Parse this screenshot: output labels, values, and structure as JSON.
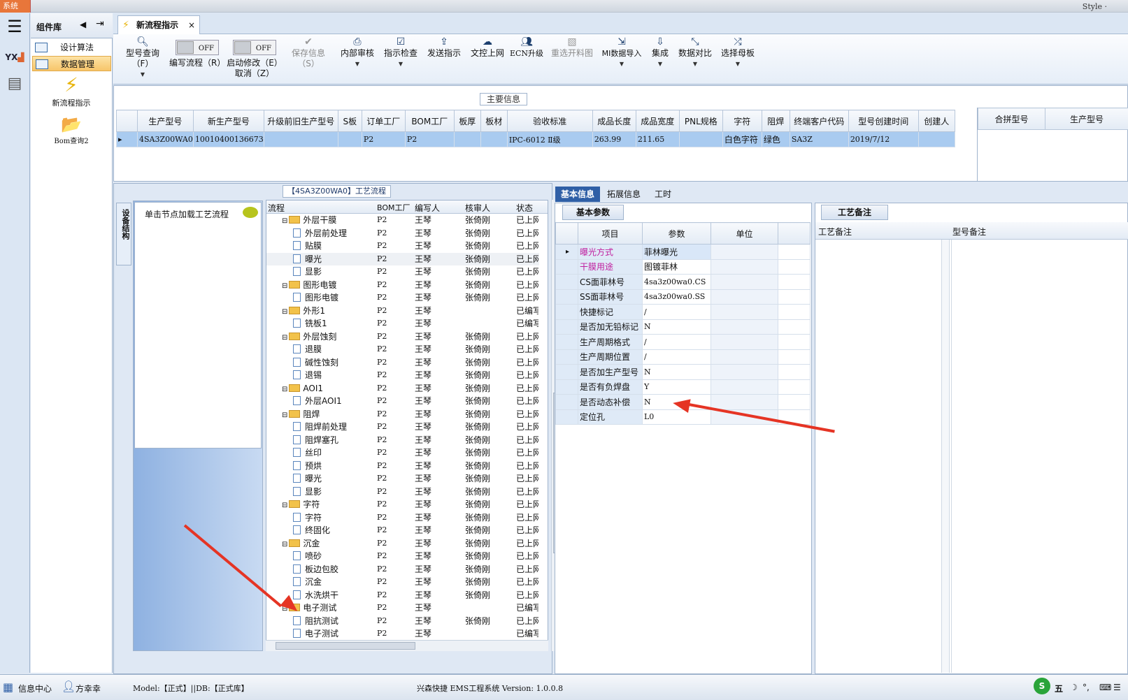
{
  "titlebar": {
    "system_menu": "系统",
    "style_label": "Style ·"
  },
  "library": {
    "title": "组件库",
    "items": [
      {
        "label": "设计算法"
      },
      {
        "label": "数据管理"
      }
    ],
    "big_items": [
      {
        "label": "新流程指示"
      },
      {
        "label": "Bom查询2"
      }
    ]
  },
  "document_tab": {
    "label": "新流程指示"
  },
  "toolbar": {
    "buttons": [
      {
        "label": "型号查询（F）",
        "icon": "search-icon",
        "dropdown": true
      },
      {
        "label": "编写流程（R）",
        "toggle": "OFF"
      },
      {
        "label": "启动修改（E）",
        "toggle": "OFF",
        "sub_label": "取消（Z）"
      },
      {
        "label": "保存信息（S）",
        "icon": "check-icon",
        "disabled": true
      },
      {
        "label": "内部审核",
        "icon": "printer-icon",
        "dropdown": true
      },
      {
        "label": "指示检查",
        "icon": "checkbox-icon",
        "dropdown": true
      },
      {
        "label": "发送指示",
        "icon": "upload-icon"
      },
      {
        "label": "文控上网",
        "icon": "cloud-icon"
      },
      {
        "label": "ECN升级",
        "icon": "people-icon"
      },
      {
        "label": "重选开料图",
        "icon": "image-icon",
        "disabled": true
      },
      {
        "label": "MI数据导入",
        "icon": "import-icon",
        "dropdown": true
      },
      {
        "label": "集成",
        "icon": "download-icon",
        "dropdown": true
      },
      {
        "label": "数据对比",
        "icon": "compare-icon",
        "dropdown": true
      },
      {
        "label": "选择母板",
        "icon": "shuffle-icon",
        "dropdown": true
      }
    ]
  },
  "main_info": {
    "label": "主要信息",
    "columns": [
      "生产型号",
      "新生产型号",
      "升级前旧生产型号",
      "S板",
      "订单工厂",
      "BOM工厂",
      "板厚",
      "板材",
      "验收标准",
      "成品长度",
      "成品宽度",
      "PNL规格",
      "字符",
      "阻焊",
      "终端客户代码",
      "型号创建时间",
      "创建人"
    ],
    "rows": [
      [
        "4SA3Z00WA0",
        "10010400136673",
        "",
        "",
        "P2",
        "P2",
        "",
        "",
        "IPC-6012 Ⅱ级",
        "263.99",
        "211.65",
        "",
        "白色字符",
        "绿色",
        "SA3Z",
        "2019/7/12",
        ""
      ]
    ],
    "merge_columns": [
      "合拼型号",
      "生产型号"
    ]
  },
  "process_flow": {
    "title": "【4SA3Z00WA0】工艺流程",
    "side_tab": "设备结构",
    "tip": "单击节点加载工艺流程",
    "columns": [
      "流程",
      "BOM工厂",
      "编写人",
      "核审人",
      "状态"
    ],
    "rows": [
      {
        "name": "外层干膜",
        "folder": true,
        "bom": "P2",
        "writer": "王琴",
        "reviewer": "张倚刚",
        "status": "已上网"
      },
      {
        "name": "外层前处理",
        "folder": false,
        "bom": "P2",
        "writer": "王琴",
        "reviewer": "张倚刚",
        "status": "已上网"
      },
      {
        "name": "贴膜",
        "folder": false,
        "bom": "P2",
        "writer": "王琴",
        "reviewer": "张倚刚",
        "status": "已上网"
      },
      {
        "name": "曝光",
        "folder": false,
        "bom": "P2",
        "writer": "王琴",
        "reviewer": "张倚刚",
        "status": "已上网",
        "highlight": true
      },
      {
        "name": "显影",
        "folder": false,
        "bom": "P2",
        "writer": "王琴",
        "reviewer": "张倚刚",
        "status": "已上网"
      },
      {
        "name": "图形电镀",
        "folder": true,
        "bom": "P2",
        "writer": "王琴",
        "reviewer": "张倚刚",
        "status": "已上网"
      },
      {
        "name": "图形电镀",
        "folder": false,
        "bom": "P2",
        "writer": "王琴",
        "reviewer": "张倚刚",
        "status": "已上网"
      },
      {
        "name": "外形1",
        "folder": true,
        "bom": "P2",
        "writer": "王琴",
        "reviewer": "",
        "status": "已编写"
      },
      {
        "name": "铣板1",
        "folder": false,
        "bom": "P2",
        "writer": "王琴",
        "reviewer": "",
        "status": "已编写"
      },
      {
        "name": "外层蚀刻",
        "folder": true,
        "bom": "P2",
        "writer": "王琴",
        "reviewer": "张倚刚",
        "status": "已上网"
      },
      {
        "name": "退膜",
        "folder": false,
        "bom": "P2",
        "writer": "王琴",
        "reviewer": "张倚刚",
        "status": "已上网"
      },
      {
        "name": "碱性蚀刻",
        "folder": false,
        "bom": "P2",
        "writer": "王琴",
        "reviewer": "张倚刚",
        "status": "已上网"
      },
      {
        "name": "退锡",
        "folder": false,
        "bom": "P2",
        "writer": "王琴",
        "reviewer": "张倚刚",
        "status": "已上网"
      },
      {
        "name": "AOI1",
        "folder": true,
        "bom": "P2",
        "writer": "王琴",
        "reviewer": "张倚刚",
        "status": "已上网"
      },
      {
        "name": "外层AOI1",
        "folder": false,
        "bom": "P2",
        "writer": "王琴",
        "reviewer": "张倚刚",
        "status": "已上网"
      },
      {
        "name": "阻焊",
        "folder": true,
        "bom": "P2",
        "writer": "王琴",
        "reviewer": "张倚刚",
        "status": "已上网"
      },
      {
        "name": "阻焊前处理",
        "folder": false,
        "bom": "P2",
        "writer": "王琴",
        "reviewer": "张倚刚",
        "status": "已上网"
      },
      {
        "name": "阻焊塞孔",
        "folder": false,
        "bom": "P2",
        "writer": "王琴",
        "reviewer": "张倚刚",
        "status": "已上网"
      },
      {
        "name": "丝印",
        "folder": false,
        "bom": "P2",
        "writer": "王琴",
        "reviewer": "张倚刚",
        "status": "已上网"
      },
      {
        "name": "预烘",
        "folder": false,
        "bom": "P2",
        "writer": "王琴",
        "reviewer": "张倚刚",
        "status": "已上网"
      },
      {
        "name": "曝光",
        "folder": false,
        "bom": "P2",
        "writer": "王琴",
        "reviewer": "张倚刚",
        "status": "已上网"
      },
      {
        "name": "显影",
        "folder": false,
        "bom": "P2",
        "writer": "王琴",
        "reviewer": "张倚刚",
        "status": "已上网"
      },
      {
        "name": "字符",
        "folder": true,
        "bom": "P2",
        "writer": "王琴",
        "reviewer": "张倚刚",
        "status": "已上网"
      },
      {
        "name": "字符",
        "folder": false,
        "bom": "P2",
        "writer": "王琴",
        "reviewer": "张倚刚",
        "status": "已上网"
      },
      {
        "name": "终固化",
        "folder": false,
        "bom": "P2",
        "writer": "王琴",
        "reviewer": "张倚刚",
        "status": "已上网"
      },
      {
        "name": "沉金",
        "folder": true,
        "bom": "P2",
        "writer": "王琴",
        "reviewer": "张倚刚",
        "status": "已上网"
      },
      {
        "name": "喷砂",
        "folder": false,
        "bom": "P2",
        "writer": "王琴",
        "reviewer": "张倚刚",
        "status": "已上网"
      },
      {
        "name": "板边包胶",
        "folder": false,
        "bom": "P2",
        "writer": "王琴",
        "reviewer": "张倚刚",
        "status": "已上网"
      },
      {
        "name": "沉金",
        "folder": false,
        "bom": "P2",
        "writer": "王琴",
        "reviewer": "张倚刚",
        "status": "已上网"
      },
      {
        "name": "水洗烘干",
        "folder": false,
        "bom": "P2",
        "writer": "王琴",
        "reviewer": "张倚刚",
        "status": "已上网"
      },
      {
        "name": "电子测试",
        "folder": true,
        "bom": "P2",
        "writer": "王琴",
        "reviewer": "",
        "status": "已编写"
      },
      {
        "name": "阻抗测试",
        "folder": false,
        "bom": "P2",
        "writer": "王琴",
        "reviewer": "张倚刚",
        "status": "已上网"
      },
      {
        "name": "电子测试",
        "folder": false,
        "bom": "P2",
        "writer": "王琴",
        "reviewer": "",
        "status": "已编写"
      }
    ]
  },
  "detail": {
    "tabs": [
      {
        "label": "基本信息"
      },
      {
        "label": "拓展信息"
      },
      {
        "label": "工时"
      }
    ],
    "basic_title": "基本参数",
    "param_columns": [
      "项目",
      "参数",
      "单位"
    ],
    "params": [
      {
        "name": "曝光方式",
        "value": "菲林曝光",
        "color": "#c0209f"
      },
      {
        "name": "干膜用途",
        "value": "图镀菲林",
        "color": "#c0209f"
      },
      {
        "name": "CS面菲林号",
        "value": "4sa3z00wa0.CS"
      },
      {
        "name": "SS面菲林号",
        "value": "4sa3z00wa0.SS"
      },
      {
        "name": "快捷标记",
        "value": "/"
      },
      {
        "name": "是否加无铅标记",
        "value": "N"
      },
      {
        "name": "生产周期格式",
        "value": "/"
      },
      {
        "name": "生产周期位置",
        "value": "/"
      },
      {
        "name": "是否加生产型号",
        "value": "N"
      },
      {
        "name": "是否有负焊盘",
        "value": "Y"
      },
      {
        "name": "是否动态补偿",
        "value": "N"
      },
      {
        "name": "定位孔",
        "value": "L0"
      }
    ],
    "note_title": "工艺备注",
    "note_columns": [
      "工艺备注",
      "型号备注"
    ]
  },
  "statusbar": {
    "info_center": "信息中心",
    "user": "方幸幸",
    "db": "Model:【正式】||DB:【正式库】",
    "version": "兴森快捷 EMS工程系统 Version: 1.0.0.8",
    "ime": "五"
  },
  "colors": {
    "accent": "#2f5fa6",
    "selection": "#a9cbf0",
    "arrow": "#e53424",
    "folder": "#f2c24a"
  }
}
